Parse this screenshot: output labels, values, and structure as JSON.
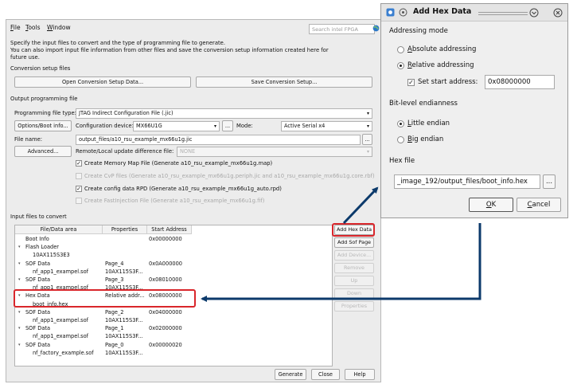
{
  "menu": {
    "file": "File",
    "tools": "Tools",
    "window": "Window"
  },
  "search": {
    "placeholder": "Search intel FPGA"
  },
  "intro": {
    "line1": "Specify the input files to convert and the type of programming file to generate.",
    "line2": "You can also import input file information from other files and save the conversion setup information created here for",
    "line3": "future use."
  },
  "setup": {
    "heading": "Conversion setup files",
    "open_label": "Open Conversion Setup Data...",
    "save_label": "Save Conversion Setup..."
  },
  "output": {
    "heading": "Output programming file",
    "type_label": "Programming file type:",
    "type_value": "JTAG Indirect Configuration File (.jic)",
    "options_label": "Options/Boot info...",
    "device_label": "Configuration device:",
    "device_value": "MX66U1G",
    "device_browse": "...",
    "mode_label": "Mode:",
    "mode_value": "Active Serial x4",
    "filename_label": "File name:",
    "filename_value": "output_files/a10_rsu_example_mx66u1g.jic",
    "filename_browse": "...",
    "advanced_label": "Advanced...",
    "remote_label": "Remote/Local update difference file:",
    "remote_value": "NONE",
    "check1": "Create Memory Map File (Generate a10_rsu_example_mx66u1g.map)",
    "check2": "Create CvP files (Generate a10_rsu_example_mx66u1g.periph.jic and a10_rsu_example_mx66u1g.core.rbf)",
    "check3": "Create config data RPD (Generate a10_rsu_example_mx66u1g_auto.rpd)",
    "check4": "Create FastInjection File (Generate a10_rsu_example_mx66u1g.fif)",
    "check_mark": "✓"
  },
  "input": {
    "heading": "Input files to convert",
    "columns": [
      "File/Data area",
      "Properties",
      "Start Address"
    ],
    "rows": [
      {
        "toggle": "",
        "name": "Boot Info",
        "props": "",
        "addr": "0x00000000"
      },
      {
        "toggle": "▾",
        "name": "Flash Loader",
        "props": "",
        "addr": ""
      },
      {
        "toggle": "",
        "name": "10AX115S3E3",
        "props": "",
        "addr": ""
      },
      {
        "toggle": "▾",
        "name": "SOF Data",
        "props": "Page_4",
        "addr": "0x0A000000"
      },
      {
        "toggle": "",
        "name": "nf_app1_exampel.sof",
        "props": "10AX115S3F...",
        "addr": ""
      },
      {
        "toggle": "▾",
        "name": "SOF Data",
        "props": "Page_3",
        "addr": "0x08010000"
      },
      {
        "toggle": "",
        "name": "nf_app1_exampel.sof",
        "props": "10AX115S3F...",
        "addr": ""
      },
      {
        "toggle": "▾",
        "name": "Hex Data",
        "props": "Relative addr...",
        "addr": "0x08000000"
      },
      {
        "toggle": "",
        "name": "boot_info.hex",
        "props": "",
        "addr": ""
      },
      {
        "toggle": "▾",
        "name": "SOF Data",
        "props": "Page_2",
        "addr": "0x04000000"
      },
      {
        "toggle": "",
        "name": "nf_app1_exampel.sof",
        "props": "10AX115S3F...",
        "addr": ""
      },
      {
        "toggle": "▾",
        "name": "SOF Data",
        "props": "Page_1",
        "addr": "0x02000000"
      },
      {
        "toggle": "",
        "name": "nf_app1_exampel.sof",
        "props": "10AX115S3F...",
        "addr": ""
      },
      {
        "toggle": "▾",
        "name": "SOF Data",
        "props": "Page_0",
        "addr": "0x00000020"
      },
      {
        "toggle": "",
        "name": "nf_factory_example.sof",
        "props": "10AX115S3F...",
        "addr": ""
      }
    ],
    "buttons": {
      "add_hex": "Add Hex Data",
      "add_sof": "Add Sof Page",
      "add_device": "Add Device...",
      "remove": "Remove",
      "up": "Up",
      "down": "Down",
      "properties": "Properties"
    }
  },
  "footer": {
    "generate": "Generate",
    "close": "Close",
    "help": "Help"
  },
  "dialog": {
    "title": "Add Hex Data",
    "addressing_heading": "Addressing mode",
    "absolute_label": "Absolute addressing",
    "relative_label": "Relative addressing",
    "start_label": "Set start address:",
    "start_value": "0x08000000",
    "check_mark": "✓",
    "endianness_heading": "Bit-level endianness",
    "little_label": "Little endian",
    "big_label": "Big endian",
    "hexfile_heading": "Hex file",
    "hexfile_value": "_image_192/output_files/boot_info.hex",
    "hexfile_browse": "...",
    "ok_label": "OK",
    "cancel_label": "Cancel"
  },
  "colors": {
    "highlight": "#d9262b",
    "arrow": "#0c3a6b"
  }
}
